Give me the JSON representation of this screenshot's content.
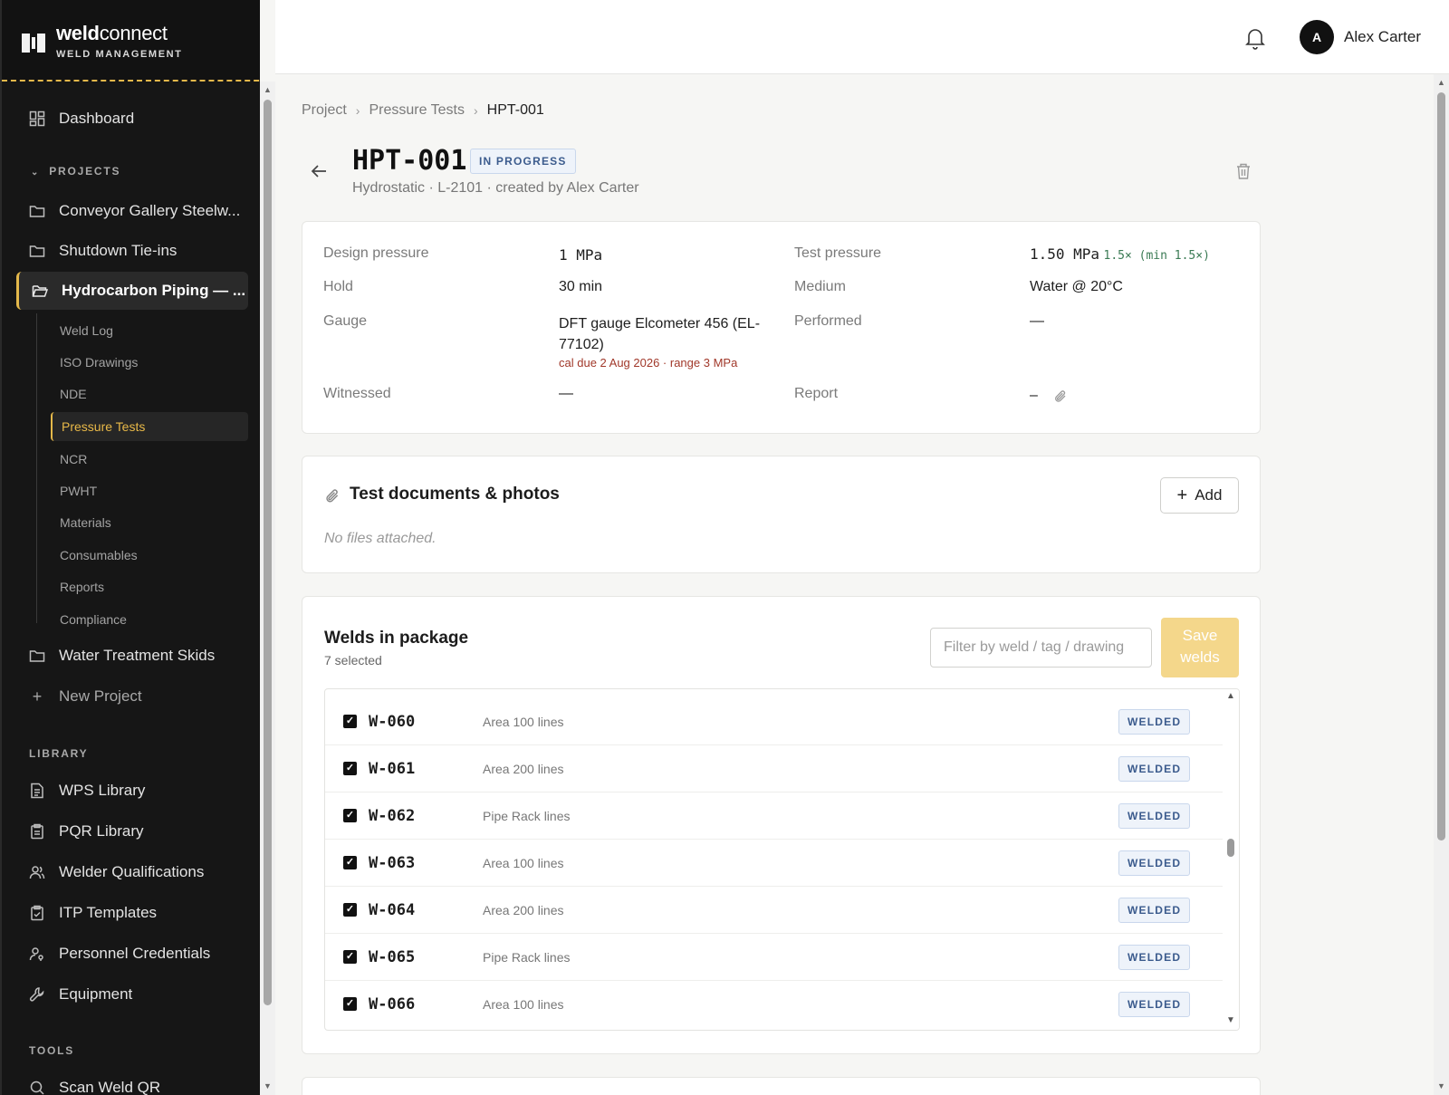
{
  "brand": {
    "name_bold": "weld",
    "name_rest": "connect",
    "subtitle": "WELD MANAGEMENT"
  },
  "sidebar": {
    "dashboard": "Dashboard",
    "projects_label": "PROJECTS",
    "projects": [
      {
        "label": "Conveyor Gallery Steelw...",
        "icon": "folder-icon"
      },
      {
        "label": "Shutdown Tie-ins",
        "icon": "folder-icon"
      },
      {
        "label": "Hydrocarbon Piping — ...",
        "icon": "folder-open-icon",
        "active": true
      }
    ],
    "subitems": [
      "Weld Log",
      "ISO Drawings",
      "NDE",
      "Pressure Tests",
      "NCR",
      "PWHT",
      "Materials",
      "Consumables",
      "Reports",
      "Compliance"
    ],
    "active_subitem": "Pressure Tests",
    "project_after": "Water Treatment Skids",
    "new_project": "New Project",
    "library_label": "LIBRARY",
    "library": [
      "WPS Library",
      "PQR Library",
      "Welder Qualifications",
      "ITP Templates",
      "Personnel Credentials",
      "Equipment"
    ],
    "tools_label": "TOOLS",
    "tools": [
      "Scan Weld QR"
    ]
  },
  "topbar": {
    "avatar_initial": "A",
    "user_name": "Alex Carter"
  },
  "breadcrumb": [
    "Project",
    "Pressure Tests",
    "HPT-001"
  ],
  "header": {
    "title": "HPT-001",
    "status": "IN PROGRESS",
    "subtitle": "Hydrostatic · L-2101 · created by Alex Carter"
  },
  "details": {
    "design_pressure_label": "Design pressure",
    "design_pressure": "1 MPa",
    "test_pressure_label": "Test pressure",
    "test_pressure": "1.50 MPa",
    "test_pressure_ratio": "1.5× (min 1.5×)",
    "hold_label": "Hold",
    "hold": "30 min",
    "medium_label": "Medium",
    "medium": "Water @ 20°C",
    "gauge_label": "Gauge",
    "gauge": "DFT gauge Elcometer 456 (EL-77102)",
    "gauge_note": "cal due 2 Aug 2026 · range 3 MPa",
    "performed_label": "Performed",
    "performed": "—",
    "witnessed_label": "Witnessed",
    "witnessed": "—",
    "report_label": "Report",
    "report": "–"
  },
  "documents": {
    "title": "Test documents & photos",
    "add_label": "Add",
    "empty": "No files attached."
  },
  "welds": {
    "title": "Welds in package",
    "selected": "7 selected",
    "filter_placeholder": "Filter by weld / tag / drawing",
    "save_label": "Save welds",
    "rows": [
      {
        "id": "W-060",
        "area": "Area 100 lines",
        "status": "WELDED",
        "checked": true
      },
      {
        "id": "W-061",
        "area": "Area 200 lines",
        "status": "WELDED",
        "checked": true
      },
      {
        "id": "W-062",
        "area": "Pipe Rack lines",
        "status": "WELDED",
        "checked": true
      },
      {
        "id": "W-063",
        "area": "Area 100 lines",
        "status": "WELDED",
        "checked": true
      },
      {
        "id": "W-064",
        "area": "Area 200 lines",
        "status": "WELDED",
        "checked": true
      },
      {
        "id": "W-065",
        "area": "Pipe Rack lines",
        "status": "WELDED",
        "checked": true
      },
      {
        "id": "W-066",
        "area": "Area 100 lines",
        "status": "WELDED",
        "checked": true
      }
    ]
  },
  "colors": {
    "accent": "#e4b84a",
    "sidebar_bg": "#161616",
    "badge_text": "#3b5b8d",
    "save_disabled": "#f4d78b",
    "cal_note": "#a1382a"
  }
}
